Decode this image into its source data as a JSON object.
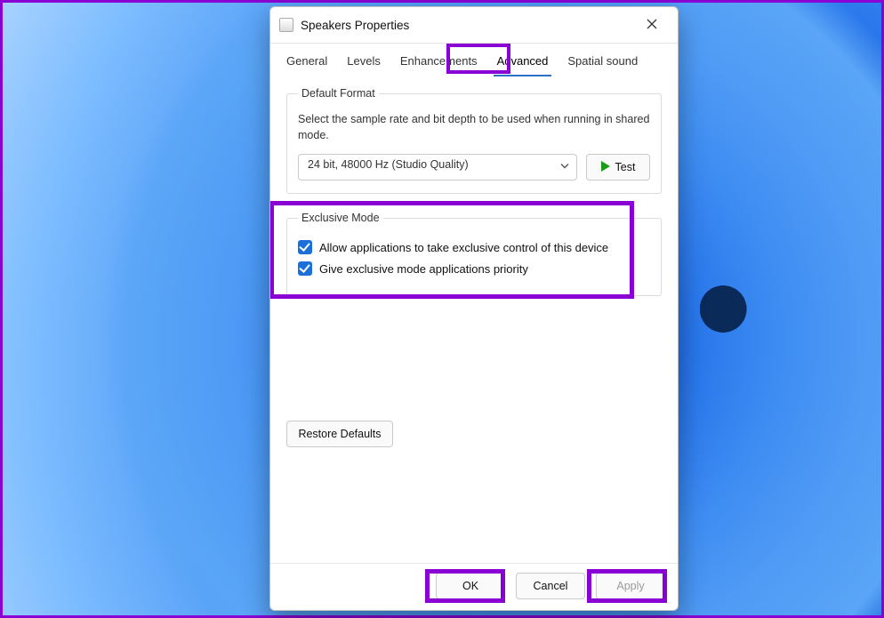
{
  "window": {
    "title": "Speakers Properties"
  },
  "tabs": {
    "general": "General",
    "levels": "Levels",
    "enhancements": "Enhancements",
    "advanced": "Advanced",
    "spatial": "Spatial sound",
    "active": "advanced"
  },
  "default_format": {
    "legend": "Default Format",
    "help": "Select the sample rate and bit depth to be used when running in shared mode.",
    "selected": "24 bit, 48000 Hz (Studio Quality)",
    "test_label": "Test"
  },
  "exclusive_mode": {
    "legend": "Exclusive Mode",
    "option_allow": {
      "label": "Allow applications to take exclusive control of this device",
      "checked": true
    },
    "option_priority": {
      "label": "Give exclusive mode applications priority",
      "checked": true
    }
  },
  "restore_defaults_label": "Restore Defaults",
  "footer": {
    "ok": "OK",
    "cancel": "Cancel",
    "apply": "Apply"
  }
}
